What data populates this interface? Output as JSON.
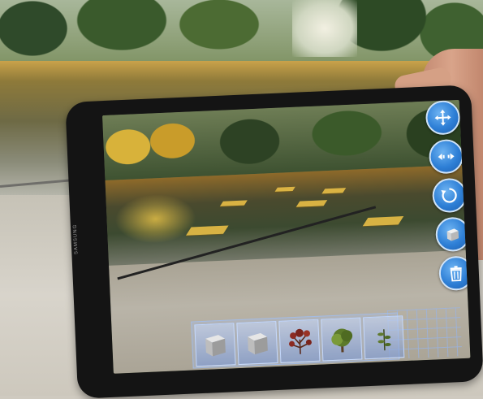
{
  "device": {
    "brand_label": "SAMSUNG"
  },
  "toolbar": {
    "buttons": [
      {
        "icon": "move-arrows-icon",
        "action": "move"
      },
      {
        "icon": "scale-arrows-icon",
        "action": "scale"
      },
      {
        "icon": "rotate-icon",
        "action": "rotate"
      },
      {
        "icon": "cube-icon",
        "action": "add-object"
      },
      {
        "icon": "trash-icon",
        "action": "delete"
      }
    ],
    "accent_color": "#2e7fd6"
  },
  "palette": {
    "items": [
      {
        "icon": "cube-model-icon"
      },
      {
        "icon": "cube-model-icon"
      },
      {
        "icon": "red-shrub-icon"
      },
      {
        "icon": "green-bush-icon"
      },
      {
        "icon": "small-plant-icon"
      }
    ]
  },
  "ar_tiles_color": "#e8be46"
}
